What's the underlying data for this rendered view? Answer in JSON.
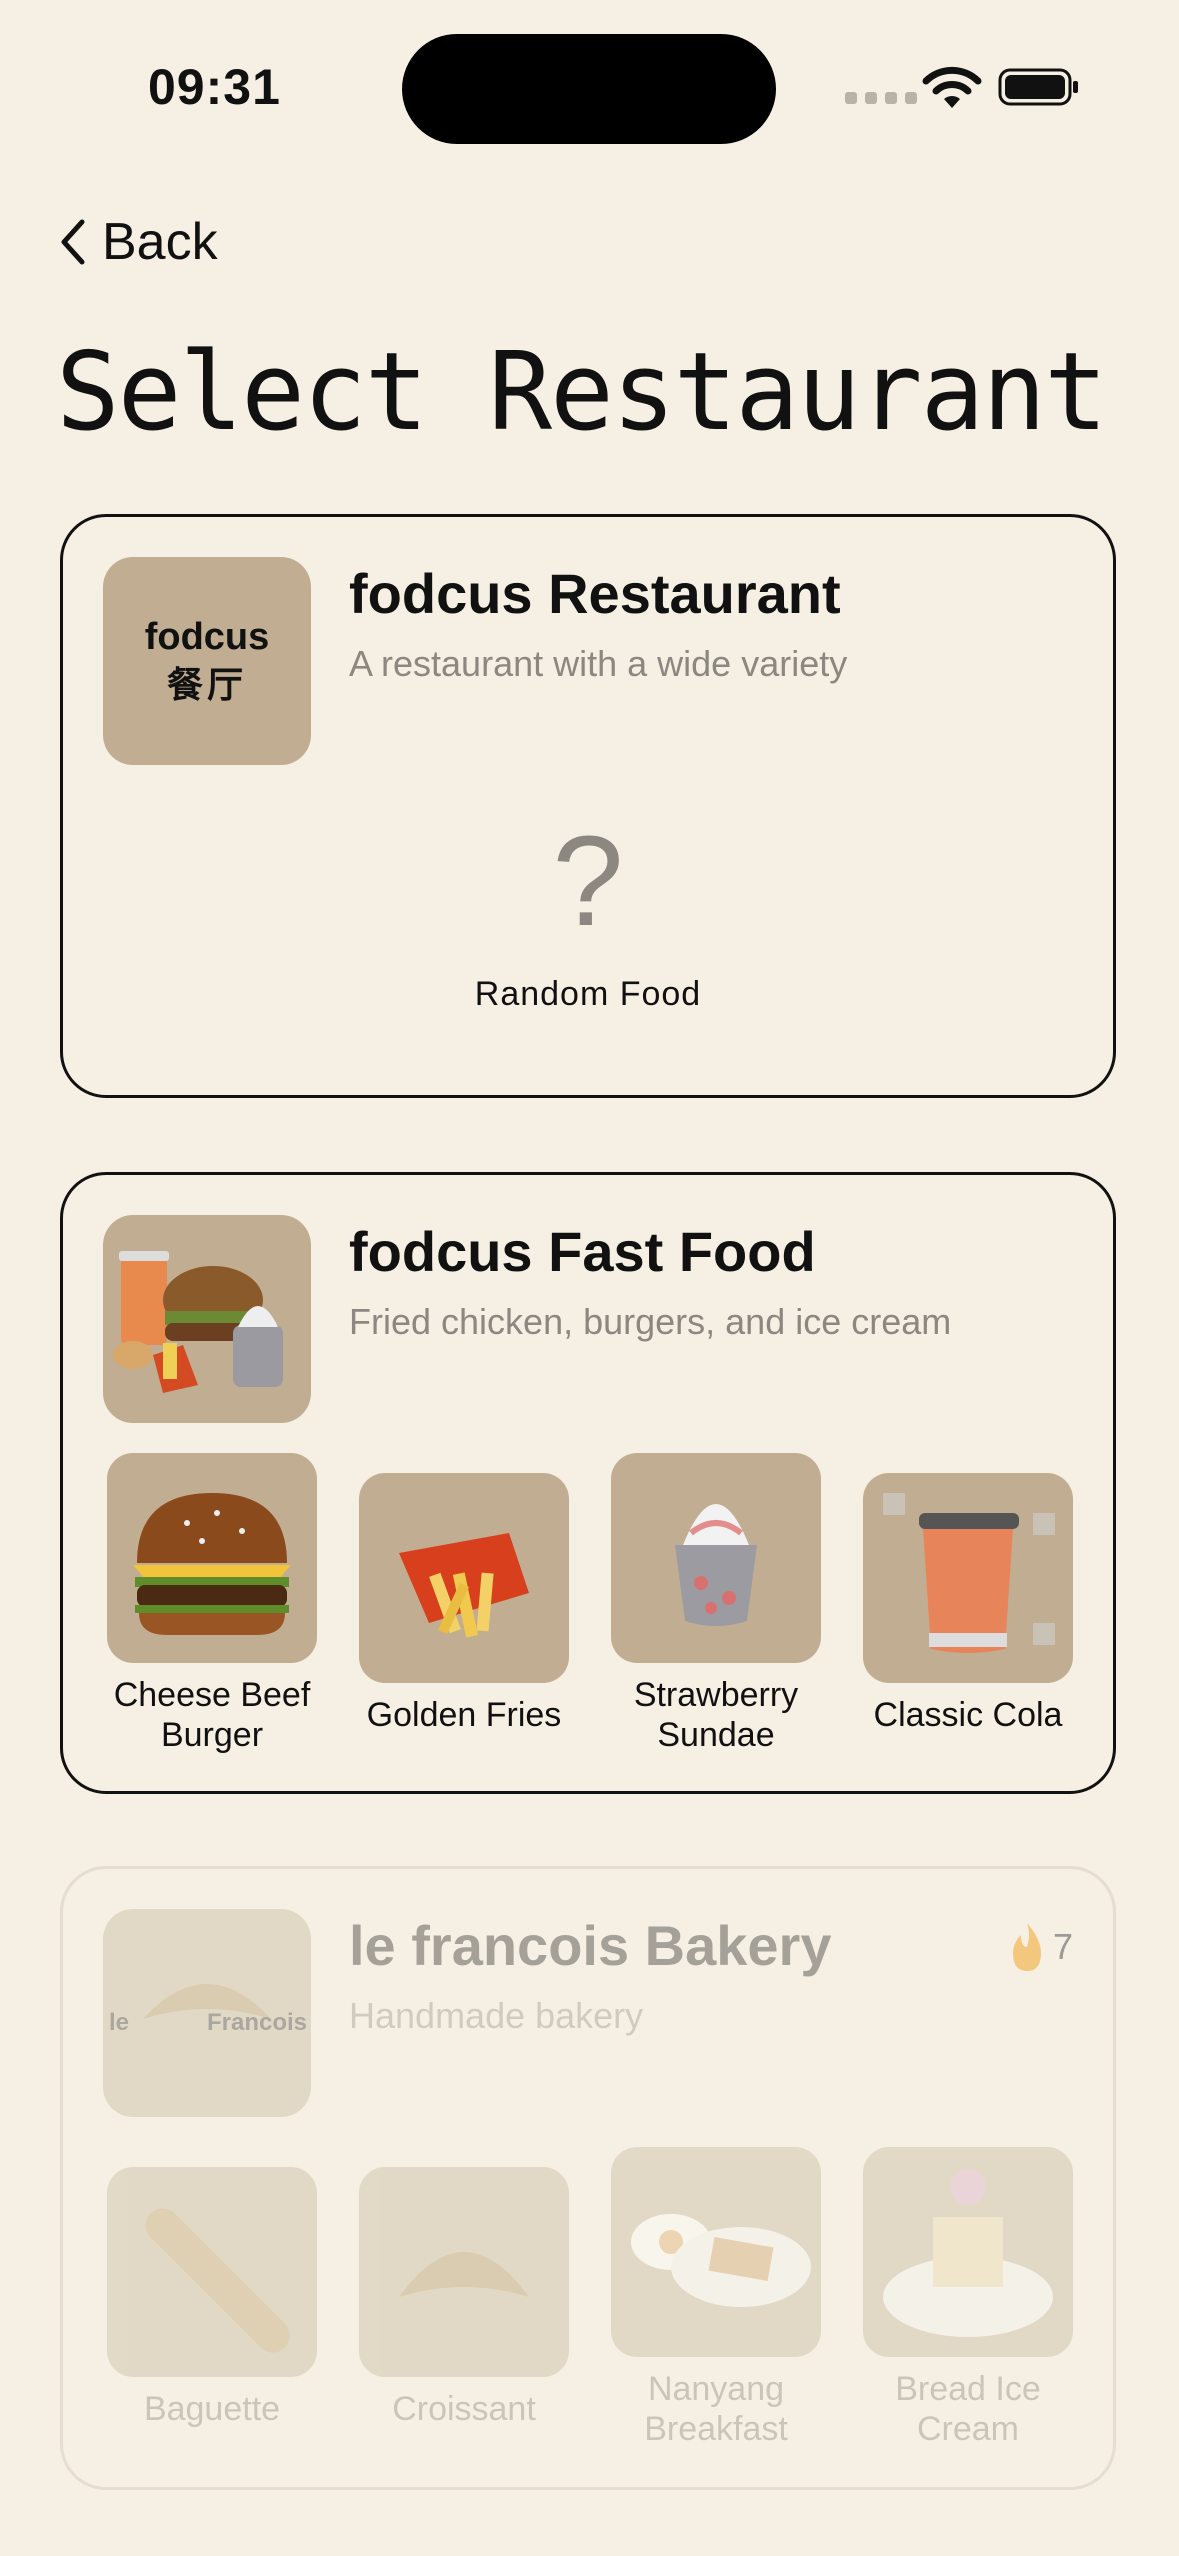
{
  "status_bar": {
    "time": "09:31"
  },
  "nav": {
    "back_label": "Back",
    "title": "Select Restaurant"
  },
  "restaurants": [
    {
      "name": "fodcus Restaurant",
      "description": "A restaurant with a wide variety",
      "logo_text_line1": "fodcus",
      "logo_text_line2": "餐厅",
      "random_symbol": "?",
      "random_label": "Random Food"
    },
    {
      "name": "fodcus Fast Food",
      "description": "Fried chicken, burgers, and ice cream",
      "items": [
        {
          "label": "Cheese Beef Burger",
          "icon": "burger-icon"
        },
        {
          "label": "Golden Fries",
          "icon": "fries-icon"
        },
        {
          "label": "Strawberry Sundae",
          "icon": "sundae-icon"
        },
        {
          "label": "Classic Cola",
          "icon": "cola-icon"
        }
      ]
    },
    {
      "name": "le francois Bakery",
      "description": "Handmade bakery",
      "logo_text_left": "le",
      "logo_text_right": "Francois",
      "badge_count": "7",
      "badge_icon": "flame-icon",
      "items": [
        {
          "label": "Baguette",
          "icon": "baguette-icon"
        },
        {
          "label": "Croissant",
          "icon": "croissant-icon"
        },
        {
          "label": "Nanyang Breakfast",
          "icon": "breakfast-icon"
        },
        {
          "label": "Bread Ice Cream",
          "icon": "bread-ice-cream-icon"
        }
      ]
    }
  ],
  "colors": {
    "background": "#f5f0e3",
    "thumb": "#c1ae92",
    "muted_text": "#8c8780"
  }
}
